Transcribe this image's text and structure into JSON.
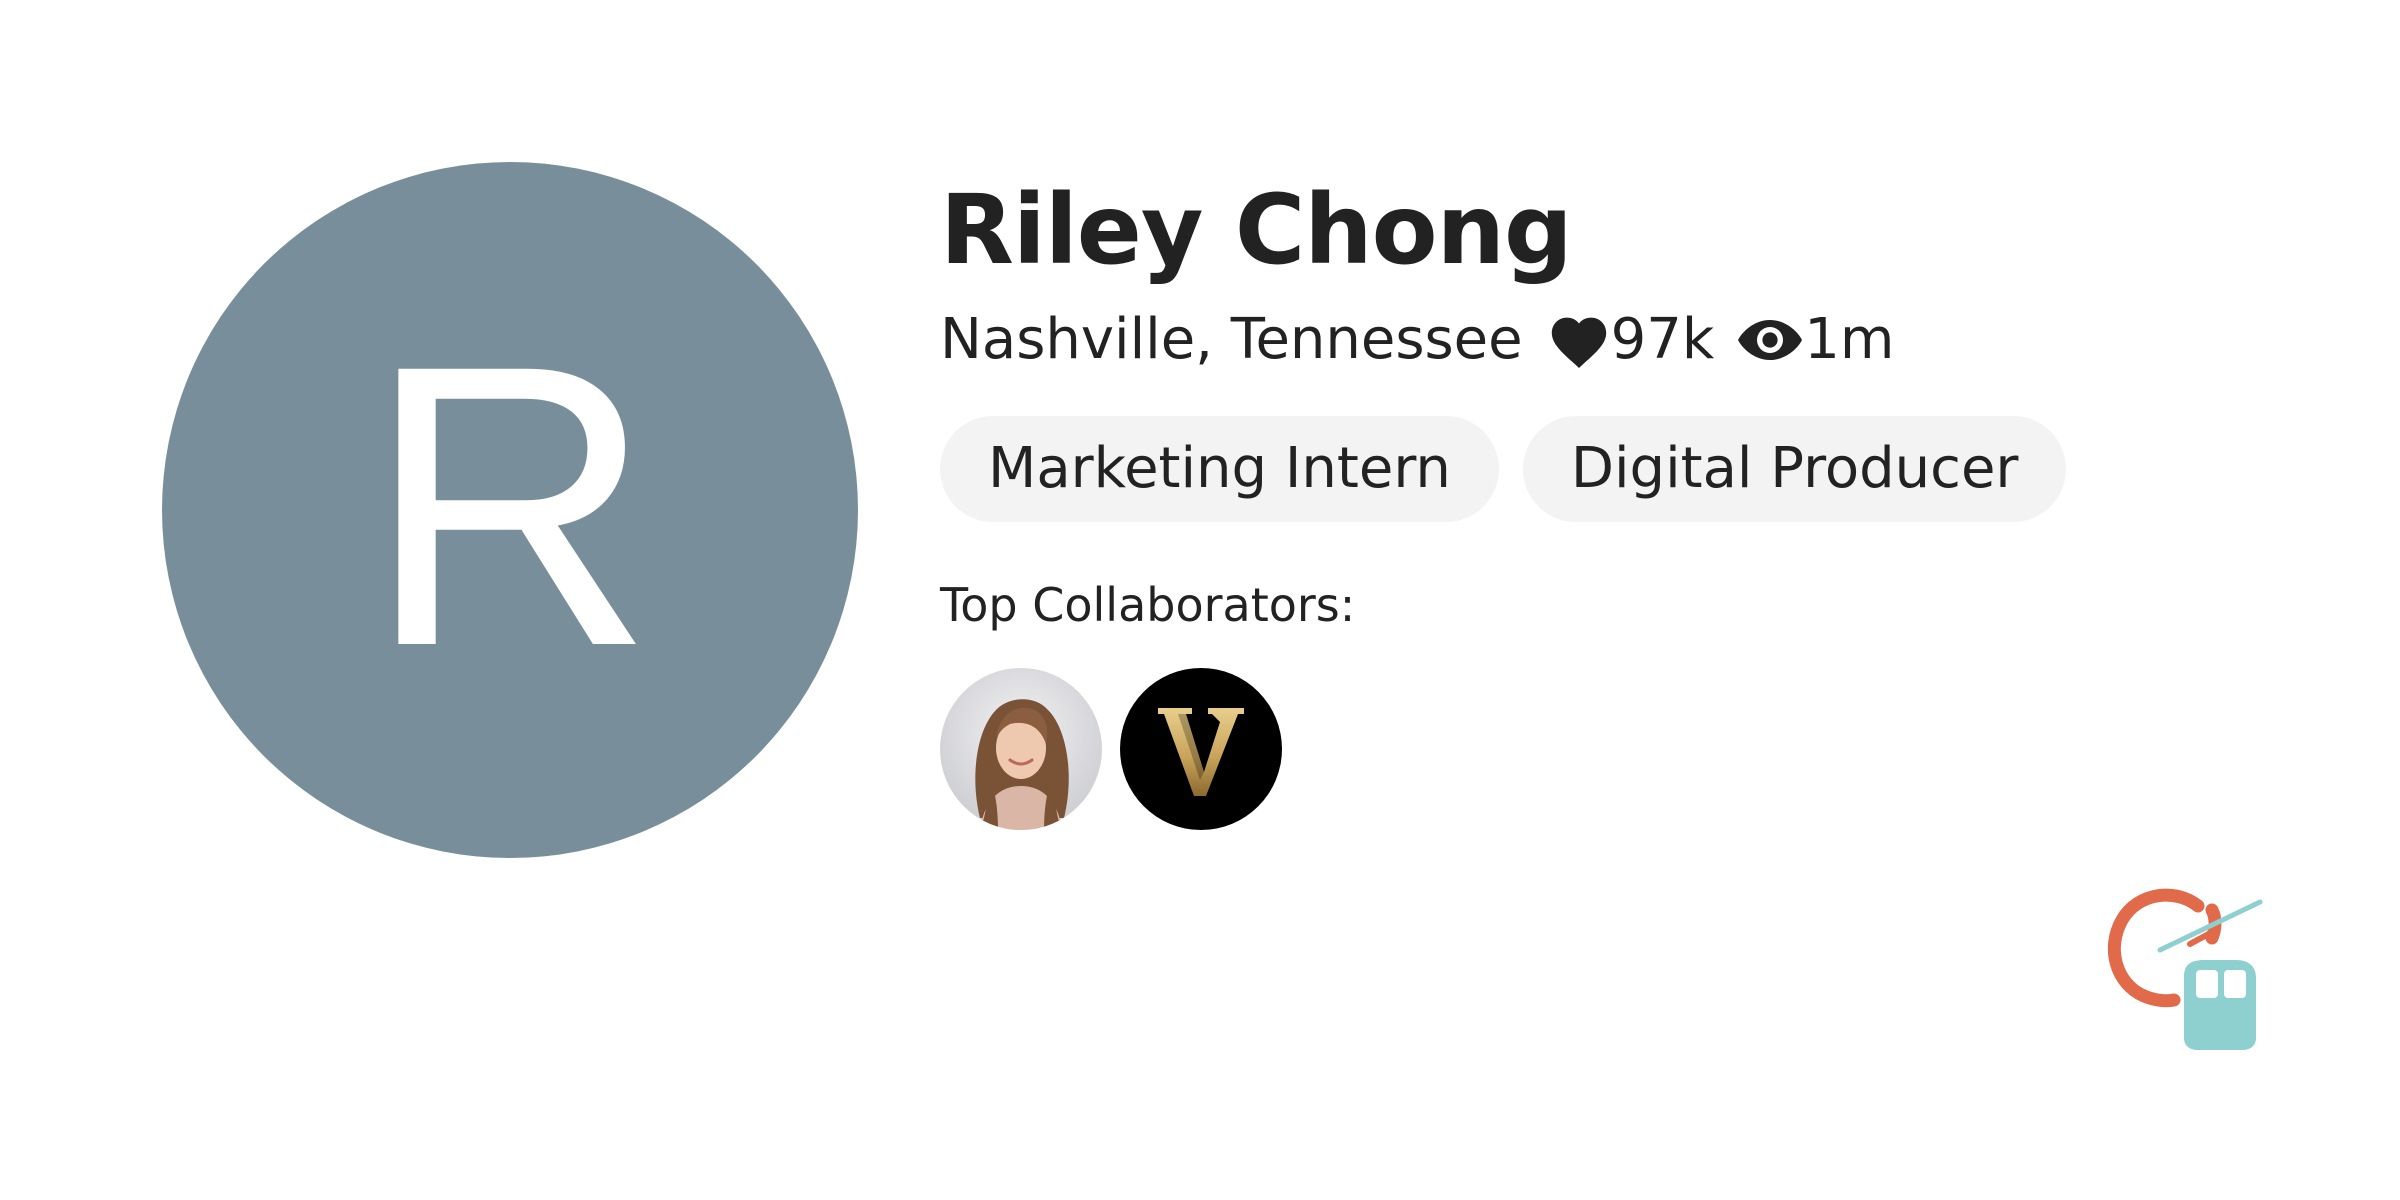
{
  "profile": {
    "avatar_initial": "R",
    "avatar_color": "#788f9b",
    "name": "Riley Chong",
    "location": "Nashville, Tennessee",
    "likes": "97k",
    "views": "1m",
    "tags": [
      "Marketing Intern",
      "Digital Producer"
    ]
  },
  "collaborators": {
    "label": "Top Collaborators:",
    "items": [
      {
        "kind": "person-photo"
      },
      {
        "kind": "v-logo"
      }
    ]
  },
  "icons": {
    "likes": "heart-icon",
    "views": "eye-icon",
    "brand": "gondola-logo"
  },
  "colors": {
    "brand_orange": "#e06a4a",
    "brand_teal": "#8ecfcf",
    "v_gold": "#c9a45b"
  }
}
